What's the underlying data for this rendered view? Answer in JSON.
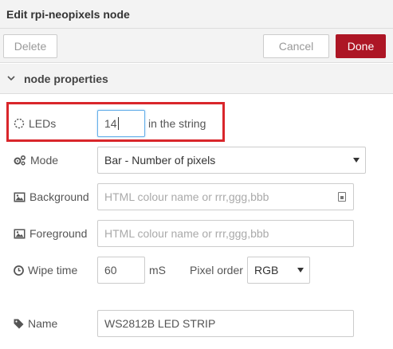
{
  "tray": {
    "title": "Edit rpi-neopixels node",
    "delete_label": "Delete",
    "cancel_label": "Cancel",
    "done_label": "Done",
    "accent": "#ad1625"
  },
  "section": {
    "title": "node properties",
    "icon": "chevron-down-icon"
  },
  "form": {
    "leds": {
      "label": "LEDs",
      "value": "14",
      "suffix": "in the string",
      "icon": "circle-dashed-icon"
    },
    "mode": {
      "label": "Mode",
      "value": "Bar - Number of pixels",
      "icon": "cogs-icon"
    },
    "background": {
      "label": "Background",
      "value": "",
      "placeholder": "HTML colour name or rrr,ggg,bbb",
      "icon": "image-icon"
    },
    "foreground": {
      "label": "Foreground",
      "value": "",
      "placeholder": "HTML colour name or rrr,ggg,bbb",
      "icon": "image-icon"
    },
    "wipe_time": {
      "label": "Wipe time",
      "value": "60",
      "unit": "mS",
      "icon": "clock-icon"
    },
    "pixel_order": {
      "label": "Pixel order",
      "value": "RGB"
    },
    "name": {
      "label": "Name",
      "value": "WS2812B LED STRIP",
      "icon": "tag-icon"
    }
  },
  "highlight_color": "#d9262b"
}
